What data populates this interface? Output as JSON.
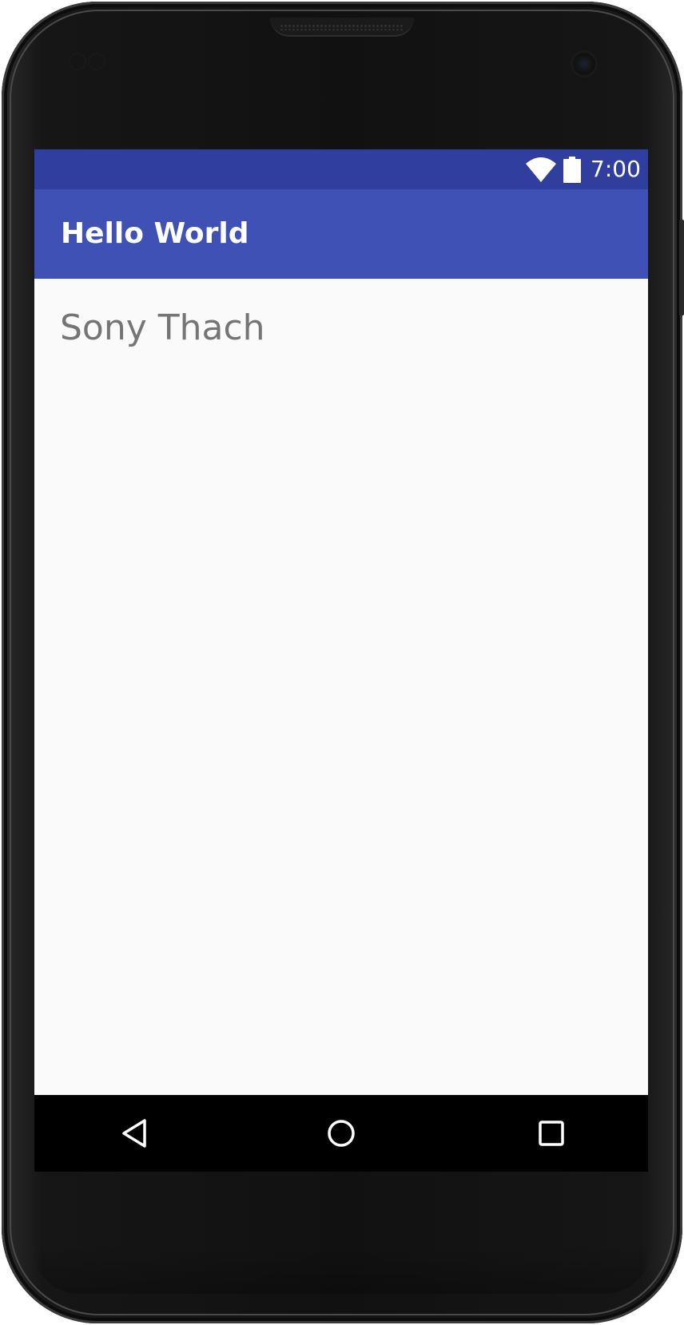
{
  "status_bar": {
    "time": "7:00",
    "wifi_icon": "wifi-full-icon",
    "battery_icon": "battery-full-icon",
    "color": "#303f9f"
  },
  "app_bar": {
    "title": "Hello World",
    "color": "#3f51b5"
  },
  "content": {
    "text": "Sony Thach",
    "text_color": "#757575",
    "background": "#fafafa"
  },
  "nav_bar": {
    "back_icon": "back-triangle-icon",
    "home_icon": "home-circle-icon",
    "recents_icon": "recents-square-icon"
  }
}
